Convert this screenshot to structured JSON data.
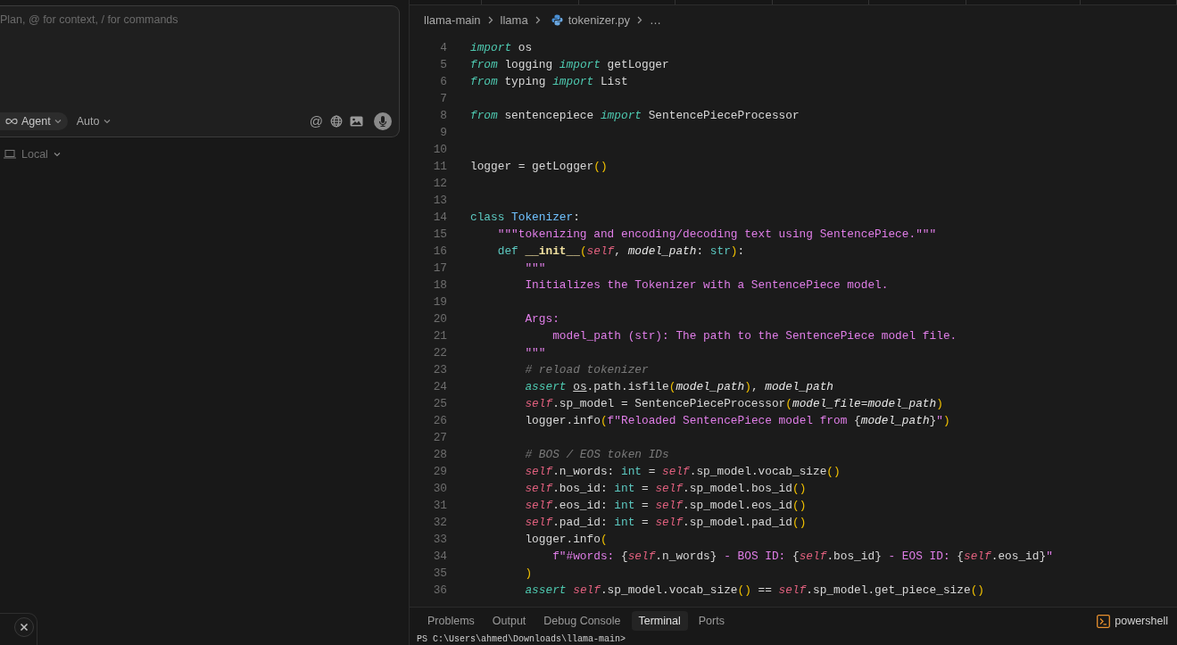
{
  "chat": {
    "placeholder": "Plan, @ for context, / for commands",
    "mode": {
      "label": "Agent"
    },
    "model": {
      "label": "Auto"
    },
    "mention": "@",
    "environment": {
      "label": "Local"
    }
  },
  "editor": {
    "breadcrumbs": [
      {
        "label": "llama-main",
        "kind": "folder"
      },
      {
        "label": "llama",
        "kind": "folder"
      },
      {
        "label": "tokenizer.py",
        "kind": "file"
      },
      {
        "label": "…",
        "kind": "more"
      }
    ],
    "lines": [
      {
        "number": "4",
        "tokens": [
          {
            "kind": "kw",
            "text": "import"
          },
          {
            "kind": "p",
            "text": " os"
          }
        ]
      },
      {
        "number": "5",
        "tokens": [
          {
            "kind": "kw",
            "text": "from"
          },
          {
            "kind": "p",
            "text": " logging "
          },
          {
            "kind": "kw",
            "text": "import"
          },
          {
            "kind": "p",
            "text": " getLogger"
          }
        ]
      },
      {
        "number": "6",
        "tokens": [
          {
            "kind": "kw",
            "text": "from"
          },
          {
            "kind": "p",
            "text": " typing "
          },
          {
            "kind": "kw",
            "text": "import"
          },
          {
            "kind": "p",
            "text": " List"
          }
        ]
      },
      {
        "number": "7"
      },
      {
        "number": "8",
        "tokens": [
          {
            "kind": "kw",
            "text": "from"
          },
          {
            "kind": "p",
            "text": " sentencepiece "
          },
          {
            "kind": "kw",
            "text": "import"
          },
          {
            "kind": "p",
            "text": " SentencePieceProcessor"
          }
        ]
      },
      {
        "number": "9"
      },
      {
        "number": "10"
      },
      {
        "number": "11",
        "tokens": [
          {
            "kind": "p",
            "text": "logger = getLogger"
          },
          {
            "kind": "y",
            "text": "()"
          }
        ]
      },
      {
        "number": "12"
      },
      {
        "number": "13"
      },
      {
        "number": "14",
        "tokens": [
          {
            "kind": "kd",
            "text": "class "
          },
          {
            "kind": "cls",
            "text": "Tokenizer"
          },
          {
            "kind": "p",
            "text": ":"
          }
        ]
      },
      {
        "number": "15",
        "tokens": [
          {
            "kind": "str",
            "text": "    \"\"\"tokenizing and encoding/decoding text using SentencePiece.\"\"\""
          }
        ]
      },
      {
        "number": "16",
        "tokens": [
          {
            "kind": "kd",
            "text": "    def "
          },
          {
            "kind": "fn",
            "text": "__init__"
          },
          {
            "kind": "y",
            "text": "("
          },
          {
            "kind": "self",
            "text": "self"
          },
          {
            "kind": "p",
            "text": ", "
          },
          {
            "kind": "param",
            "text": "model_path"
          },
          {
            "kind": "p",
            "text": ": "
          },
          {
            "kind": "kd",
            "text": "str"
          },
          {
            "kind": "y",
            "text": ")"
          },
          {
            "kind": "p",
            "text": ":"
          }
        ]
      },
      {
        "number": "17",
        "tokens": [
          {
            "kind": "str",
            "text": "        \"\"\""
          }
        ]
      },
      {
        "number": "18",
        "tokens": [
          {
            "kind": "str",
            "text": "        Initializes the Tokenizer with a SentencePiece model."
          }
        ]
      },
      {
        "number": "19"
      },
      {
        "number": "20",
        "tokens": [
          {
            "kind": "str",
            "text": "        Args:"
          }
        ]
      },
      {
        "number": "21",
        "tokens": [
          {
            "kind": "str",
            "text": "            model_path (str): The path to the SentencePiece model file."
          }
        ]
      },
      {
        "number": "22",
        "tokens": [
          {
            "kind": "str",
            "text": "        \"\"\""
          }
        ]
      },
      {
        "number": "23",
        "tokens": [
          {
            "kind": "cmt",
            "text": "        # reload tokenizer"
          }
        ]
      },
      {
        "number": "24",
        "tokens": [
          {
            "kind": "kw",
            "text": "        assert "
          },
          {
            "kind": "link",
            "text": "os"
          },
          {
            "kind": "p",
            "text": ".path.isfile"
          },
          {
            "kind": "y",
            "text": "("
          },
          {
            "kind": "param",
            "text": "model_path"
          },
          {
            "kind": "y",
            "text": ")"
          },
          {
            "kind": "p",
            "text": ", "
          },
          {
            "kind": "param",
            "text": "model_path"
          }
        ]
      },
      {
        "number": "25",
        "tokens": [
          {
            "kind": "self",
            "text": "        self"
          },
          {
            "kind": "p",
            "text": ".sp_model = SentencePieceProcessor"
          },
          {
            "kind": "y",
            "text": "("
          },
          {
            "kind": "param",
            "text": "model_file"
          },
          {
            "kind": "p",
            "text": "="
          },
          {
            "kind": "param",
            "text": "model_path"
          },
          {
            "kind": "y",
            "text": ")"
          }
        ]
      },
      {
        "number": "26",
        "tokens": [
          {
            "kind": "p",
            "text": "        logger.info"
          },
          {
            "kind": "y",
            "text": "("
          },
          {
            "kind": "str",
            "text": "f\"Reloaded SentencePiece model from "
          },
          {
            "kind": "p",
            "text": "{"
          },
          {
            "kind": "param",
            "text": "model_path"
          },
          {
            "kind": "p",
            "text": "}"
          },
          {
            "kind": "str",
            "text": "\""
          },
          {
            "kind": "y",
            "text": ")"
          }
        ]
      },
      {
        "number": "27"
      },
      {
        "number": "28",
        "tokens": [
          {
            "kind": "cmt",
            "text": "        # BOS / EOS token IDs"
          }
        ]
      },
      {
        "number": "29",
        "tokens": [
          {
            "kind": "self",
            "text": "        self"
          },
          {
            "kind": "p",
            "text": ".n_words: "
          },
          {
            "kind": "kd",
            "text": "int"
          },
          {
            "kind": "p",
            "text": " = "
          },
          {
            "kind": "self",
            "text": "self"
          },
          {
            "kind": "p",
            "text": ".sp_model.vocab_size"
          },
          {
            "kind": "y",
            "text": "()"
          }
        ]
      },
      {
        "number": "30",
        "tokens": [
          {
            "kind": "self",
            "text": "        self"
          },
          {
            "kind": "p",
            "text": ".bos_id: "
          },
          {
            "kind": "kd",
            "text": "int"
          },
          {
            "kind": "p",
            "text": " = "
          },
          {
            "kind": "self",
            "text": "self"
          },
          {
            "kind": "p",
            "text": ".sp_model.bos_id"
          },
          {
            "kind": "y",
            "text": "()"
          }
        ]
      },
      {
        "number": "31",
        "tokens": [
          {
            "kind": "self",
            "text": "        self"
          },
          {
            "kind": "p",
            "text": ".eos_id: "
          },
          {
            "kind": "kd",
            "text": "int"
          },
          {
            "kind": "p",
            "text": " = "
          },
          {
            "kind": "self",
            "text": "self"
          },
          {
            "kind": "p",
            "text": ".sp_model.eos_id"
          },
          {
            "kind": "y",
            "text": "()"
          }
        ]
      },
      {
        "number": "32",
        "tokens": [
          {
            "kind": "self",
            "text": "        self"
          },
          {
            "kind": "p",
            "text": ".pad_id: "
          },
          {
            "kind": "kd",
            "text": "int"
          },
          {
            "kind": "p",
            "text": " = "
          },
          {
            "kind": "self",
            "text": "self"
          },
          {
            "kind": "p",
            "text": ".sp_model.pad_id"
          },
          {
            "kind": "y",
            "text": "()"
          }
        ]
      },
      {
        "number": "33",
        "tokens": [
          {
            "kind": "p",
            "text": "        logger.info"
          },
          {
            "kind": "y",
            "text": "("
          }
        ]
      },
      {
        "number": "34",
        "tokens": [
          {
            "kind": "str",
            "text": "            f\"#words: "
          },
          {
            "kind": "p",
            "text": "{"
          },
          {
            "kind": "self",
            "text": "self"
          },
          {
            "kind": "p",
            "text": ".n_words}"
          },
          {
            "kind": "str",
            "text": " - BOS ID: "
          },
          {
            "kind": "p",
            "text": "{"
          },
          {
            "kind": "self",
            "text": "self"
          },
          {
            "kind": "p",
            "text": ".bos_id}"
          },
          {
            "kind": "str",
            "text": " - EOS ID: "
          },
          {
            "kind": "p",
            "text": "{"
          },
          {
            "kind": "self",
            "text": "self"
          },
          {
            "kind": "p",
            "text": ".eos_id}"
          },
          {
            "kind": "str",
            "text": "\""
          }
        ]
      },
      {
        "number": "35",
        "tokens": [
          {
            "kind": "y",
            "text": "        )"
          }
        ]
      },
      {
        "number": "36",
        "tokens": [
          {
            "kind": "kw",
            "text": "        assert "
          },
          {
            "kind": "self",
            "text": "self"
          },
          {
            "kind": "p",
            "text": ".sp_model.vocab_size"
          },
          {
            "kind": "y",
            "text": "()"
          },
          {
            "kind": "p",
            "text": " == "
          },
          {
            "kind": "self",
            "text": "self"
          },
          {
            "kind": "p",
            "text": ".sp_model.get_piece_size"
          },
          {
            "kind": "y",
            "text": "()"
          }
        ]
      }
    ]
  },
  "panel": {
    "tabs": [
      {
        "label": "Problems",
        "selected": false
      },
      {
        "label": "Output",
        "selected": false
      },
      {
        "label": "Debug Console",
        "selected": false
      },
      {
        "label": "Terminal",
        "selected": true
      },
      {
        "label": "Ports",
        "selected": false
      }
    ],
    "shell": "powershell",
    "terminal_line": "PS C:\\Users\\ahmed\\Downloads\\llama-main>"
  }
}
